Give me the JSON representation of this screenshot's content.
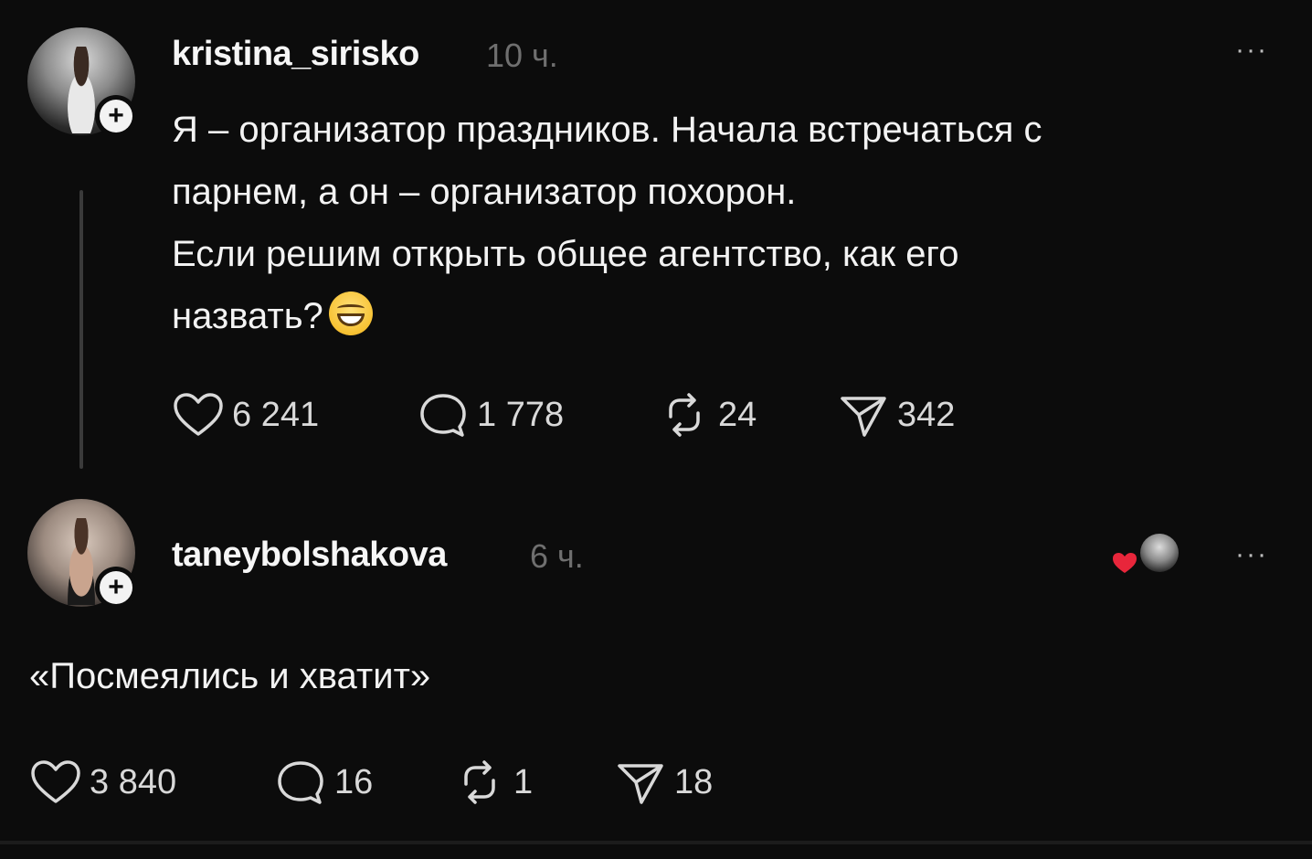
{
  "post": {
    "username": "kristina_sirisko",
    "time": "10 ч.",
    "more": "···",
    "text_lines": [
      "Я – организатор праздников. Начала встречаться с",
      "парнем, а он – организатор похорон.",
      "Если решим открыть общее агентство, как его",
      "назвать?"
    ],
    "emoji": "grinning-squinting-face",
    "stats": {
      "likes": "6 241",
      "comments": "1 778",
      "reposts": "24",
      "shares": "342"
    }
  },
  "reply": {
    "username": "taneybolshakova",
    "time": "6 ч.",
    "more": "···",
    "text": "«Посмеялись и хватит»",
    "stats": {
      "likes": "3 840",
      "comments": "16",
      "reposts": "1",
      "shares": "18"
    }
  },
  "colors": {
    "background": "#0c0c0c",
    "text": "#f3f3f3",
    "muted": "#6f6f6f",
    "heart": "#e8263b"
  }
}
